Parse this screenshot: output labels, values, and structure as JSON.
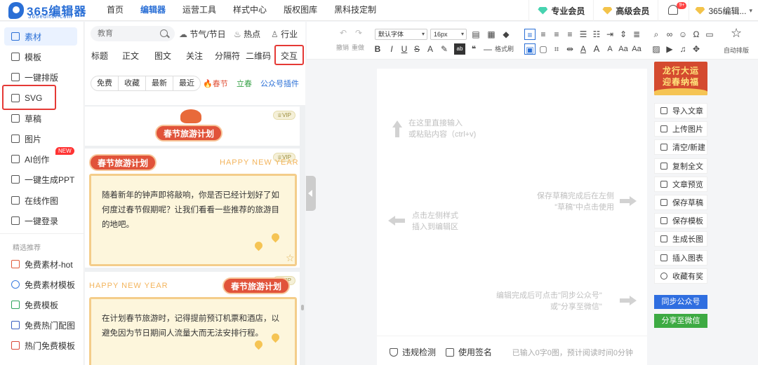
{
  "header": {
    "logo_title": "365编辑器",
    "logo_sub": "365editor.com",
    "nav": [
      "首页",
      "编辑器",
      "运营工具",
      "样式中心",
      "版权图库",
      "黑科技定制"
    ],
    "member_pro": "专业会员",
    "member_senior": "高级会员",
    "bell_badge": "9+",
    "user": "365编辑..."
  },
  "sidebar": {
    "items": [
      {
        "label": "素材",
        "icon": "material-icon"
      },
      {
        "label": "模板",
        "icon": "template-icon"
      },
      {
        "label": "一键排版",
        "icon": "layout-icon"
      },
      {
        "label": "SVG",
        "icon": "svg-icon"
      },
      {
        "label": "草稿",
        "icon": "draft-icon"
      },
      {
        "label": "图片",
        "icon": "image-icon"
      },
      {
        "label": "AI创作",
        "icon": "ai-icon"
      },
      {
        "label": "一键生成PPT",
        "icon": "ppt-icon"
      },
      {
        "label": "在线作图",
        "icon": "draw-icon"
      },
      {
        "label": "一键登录",
        "icon": "login-icon"
      }
    ],
    "new_badge": "NEW",
    "section_title": "精选推荐",
    "recommend": [
      {
        "label": "免费素材-hot"
      },
      {
        "label": "免费素材模板"
      },
      {
        "label": "免费模板"
      },
      {
        "label": "免费热门配图"
      },
      {
        "label": "热门免费模板"
      }
    ]
  },
  "panel": {
    "search_placeholder": "教育",
    "quick_links": [
      "节气/节日",
      "热点",
      "行业"
    ],
    "tabs": [
      "标题",
      "正文",
      "图文",
      "关注",
      "分隔符",
      "二维码",
      "交互"
    ],
    "filters": [
      "免费",
      "收藏",
      "最新",
      "最近"
    ],
    "festival": "春节",
    "solar_term": "立春",
    "plugin": "公众号插件",
    "vip": "VIP",
    "card_title": "春节旅游计划",
    "hny": "HAPPY NEW YEAR",
    "card2_text": "随着新年的钟声即将敲响，你是否已经计划好了如何度过春节假期呢？让我们看看一些推荐的旅游目的地吧。",
    "card3_text": "在计划春节旅游时，记得提前预订机票和酒店，以避免因为节日期间人流量大而无法安排行程。"
  },
  "toolbar": {
    "undo": "撤销",
    "redo": "重做",
    "font": "默认字体",
    "size": "16px",
    "format_painter": "格式刷",
    "auto_layout": "自动排版"
  },
  "editor": {
    "hint_top": "在这里直接输入\n或粘贴内容（ctrl+v)",
    "hint_left": "点击左侧样式\n插入到编辑区",
    "hint_right": "保存草稿完成后在左侧\n\"草稿\"中点击使用",
    "hint_bottom": "编辑完成后可点击\"同步公众号\"\n或\"分享至微信\"",
    "check": "违规检测",
    "signature": "使用签名",
    "stats": "已输入0字0图，预计阅读时间0分钟"
  },
  "right_panel": {
    "banner_line1": "龙行大运",
    "banner_line2": "迎春纳福",
    "actions": [
      "导入文章",
      "上传图片",
      "清空/新建",
      "复制全文",
      "文章预览",
      "保存草稿",
      "保存模板",
      "生成长图",
      "插入图表",
      "收藏有奖"
    ],
    "sync": "同步公众号",
    "share": "分享至微信"
  },
  "colors": {
    "accent": "#2a6fd6",
    "highlight": "#e53935",
    "festival_red": "#e1533a",
    "green": "#3aa34a",
    "sync_blue": "#2f6ee0",
    "share_green": "#3daa43"
  }
}
